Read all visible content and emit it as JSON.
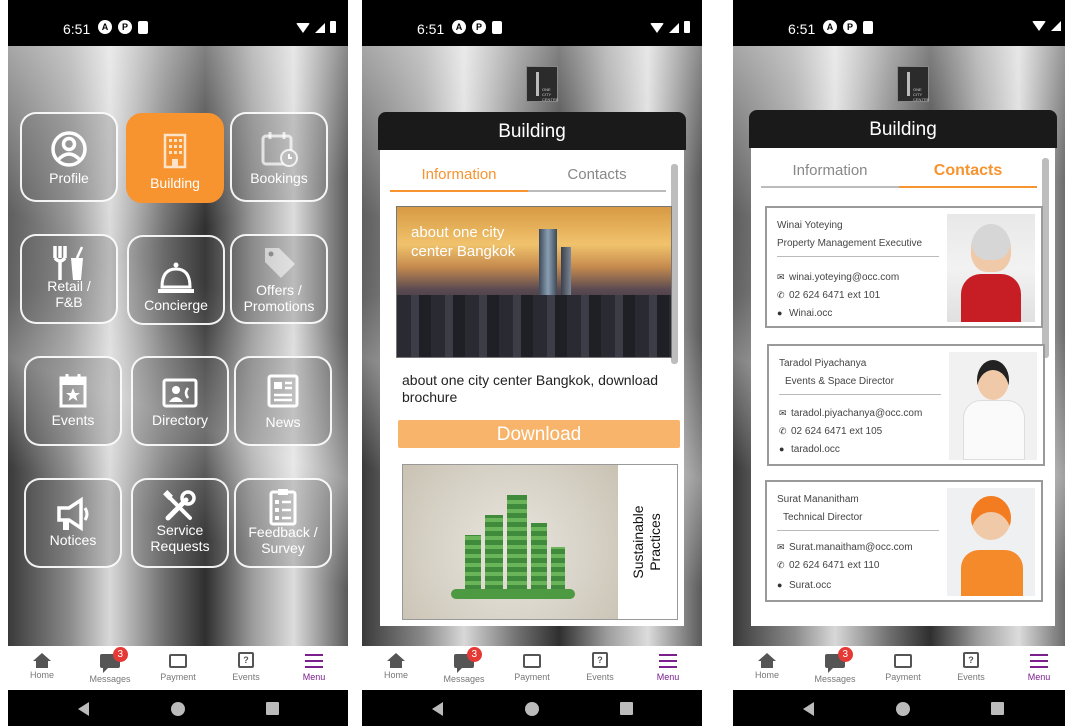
{
  "status": {
    "time": "6:51"
  },
  "tabbar": {
    "items": [
      {
        "label": "Home",
        "icon": "home-icon"
      },
      {
        "label": "Messages",
        "icon": "messages-icon",
        "badge": "3"
      },
      {
        "label": "Payment",
        "icon": "payment-icon"
      },
      {
        "label": "Events",
        "icon": "calendar-icon"
      },
      {
        "label": "Menu",
        "icon": "menu-icon"
      }
    ],
    "active": "Menu",
    "active_color": "#7a1f8c"
  },
  "menu": {
    "tiles": [
      {
        "label": "Profile",
        "icon": "profile-icon"
      },
      {
        "label": "Building",
        "icon": "building-icon",
        "active": true
      },
      {
        "label": "Bookings",
        "icon": "bookings-icon"
      },
      {
        "label": "Retail /\nF&B",
        "icon": "fork-cup-icon"
      },
      {
        "label": "Concierge",
        "icon": "concierge-bell-icon"
      },
      {
        "label": "Offers /\nPromotions",
        "icon": "tag-icon"
      },
      {
        "label": "Events",
        "icon": "event-star-icon"
      },
      {
        "label": "Directory",
        "icon": "contact-card-icon"
      },
      {
        "label": "News",
        "icon": "news-icon"
      },
      {
        "label": "Notices",
        "icon": "megaphone-icon"
      },
      {
        "label": "Service\nRequests",
        "icon": "tools-icon"
      },
      {
        "label": "Feedback /\nSurvey",
        "icon": "clipboard-icon"
      }
    ],
    "accent_color": "#f7942f"
  },
  "logo": {
    "text": "ONE CITY CENTRE"
  },
  "building": {
    "title": "Building",
    "tabs": [
      "Information",
      "Contacts"
    ],
    "hero_text": "about one city center Bangkok",
    "description": "about one city center Bangkok, download brochure",
    "download_label": "Download",
    "sustainable_label": "Sustainable\nPractices"
  },
  "contacts": [
    {
      "name": "Winai Yoteying",
      "role": "Property Management Executive",
      "email": "winai.yoteying@occ.com",
      "phone": "02 624 6471 ext 101",
      "line": "Winai.occ"
    },
    {
      "name": "Taradol Piyachanya",
      "role": "Events & Space Director",
      "email": "taradol.piyachanya@occ.com",
      "phone": "02 624 6471 ext 105",
      "line": "taradol.occ"
    },
    {
      "name": "Surat Mananitham",
      "role": "Technical Director",
      "email": "Surat.manaitham@occ.com",
      "phone": "02 624 6471 ext 110",
      "line": "Surat.occ"
    }
  ]
}
